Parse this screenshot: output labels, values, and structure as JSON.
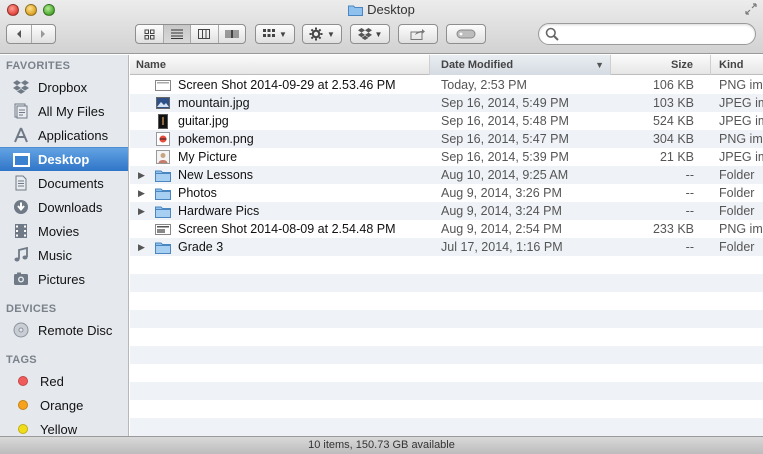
{
  "window": {
    "title": "Desktop"
  },
  "toolbar": {
    "back_icon": "chevron-left-icon",
    "forward_icon": "chevron-right-icon",
    "views": [
      "icon-view-icon",
      "list-view-icon",
      "column-view-icon",
      "coverflow-view-icon"
    ],
    "active_view": "list",
    "arrange_icon": "arrange-grid-icon",
    "action_icon": "gear-icon",
    "dropbox_icon": "dropbox-icon",
    "share_icon": "share-icon",
    "tags_icon": "tag-icon",
    "search_placeholder": ""
  },
  "sidebar": {
    "favorites_heading": "FAVORITES",
    "favorites": [
      {
        "label": "Dropbox",
        "icon": "dropbox-icon"
      },
      {
        "label": "All My Files",
        "icon": "all-files-icon"
      },
      {
        "label": "Applications",
        "icon": "applications-icon"
      },
      {
        "label": "Desktop",
        "icon": "desktop-icon",
        "selected": true
      },
      {
        "label": "Documents",
        "icon": "documents-icon"
      },
      {
        "label": "Downloads",
        "icon": "downloads-icon"
      },
      {
        "label": "Movies",
        "icon": "movies-icon"
      },
      {
        "label": "Music",
        "icon": "music-icon"
      },
      {
        "label": "Pictures",
        "icon": "pictures-icon"
      }
    ],
    "devices_heading": "DEVICES",
    "devices": [
      {
        "label": "Remote Disc",
        "icon": "disc-icon"
      }
    ],
    "tags_heading": "TAGS",
    "tags": [
      {
        "label": "Red",
        "color": "#f25b5b"
      },
      {
        "label": "Orange",
        "color": "#f7a21c"
      },
      {
        "label": "Yellow",
        "color": "#f0dc18"
      }
    ]
  },
  "file_list": {
    "columns": {
      "name": "Name",
      "date": "Date Modified",
      "size": "Size",
      "kind": "Kind"
    },
    "sort_column": "date",
    "rows": [
      {
        "name": "Screen Shot 2014-09-29 at 2.53.46 PM",
        "date": "Today, 2:53 PM",
        "size": "106 KB",
        "kind": "PNG image",
        "type": "screenshot"
      },
      {
        "name": "mountain.jpg",
        "date": "Sep 16, 2014, 5:49 PM",
        "size": "103 KB",
        "kind": "JPEG image",
        "type": "jpeg"
      },
      {
        "name": "guitar.jpg",
        "date": "Sep 16, 2014, 5:48 PM",
        "size": "524 KB",
        "kind": "JPEG image",
        "type": "jpeg-dark"
      },
      {
        "name": "pokemon.png",
        "date": "Sep 16, 2014, 5:47 PM",
        "size": "304 KB",
        "kind": "PNG image",
        "type": "png"
      },
      {
        "name": "My Picture",
        "date": "Sep 16, 2014, 5:39 PM",
        "size": "21 KB",
        "kind": "JPEG image",
        "type": "picture"
      },
      {
        "name": "New Lessons",
        "date": "Aug 10, 2014, 9:25 AM",
        "size": "--",
        "kind": "Folder",
        "type": "folder"
      },
      {
        "name": "Photos",
        "date": "Aug 9, 2014, 3:26 PM",
        "size": "--",
        "kind": "Folder",
        "type": "folder"
      },
      {
        "name": "Hardware Pics",
        "date": "Aug 9, 2014, 3:24 PM",
        "size": "--",
        "kind": "Folder",
        "type": "folder"
      },
      {
        "name": "Screen Shot 2014-08-09 at 2.54.48 PM",
        "date": "Aug 9, 2014, 2:54 PM",
        "size": "233 KB",
        "kind": "PNG image",
        "type": "screenshot"
      },
      {
        "name": "Grade 3",
        "date": "Jul 17, 2014, 1:16 PM",
        "size": "--",
        "kind": "Folder",
        "type": "folder"
      }
    ]
  },
  "status": {
    "text": "10 items, 150.73 GB available"
  }
}
